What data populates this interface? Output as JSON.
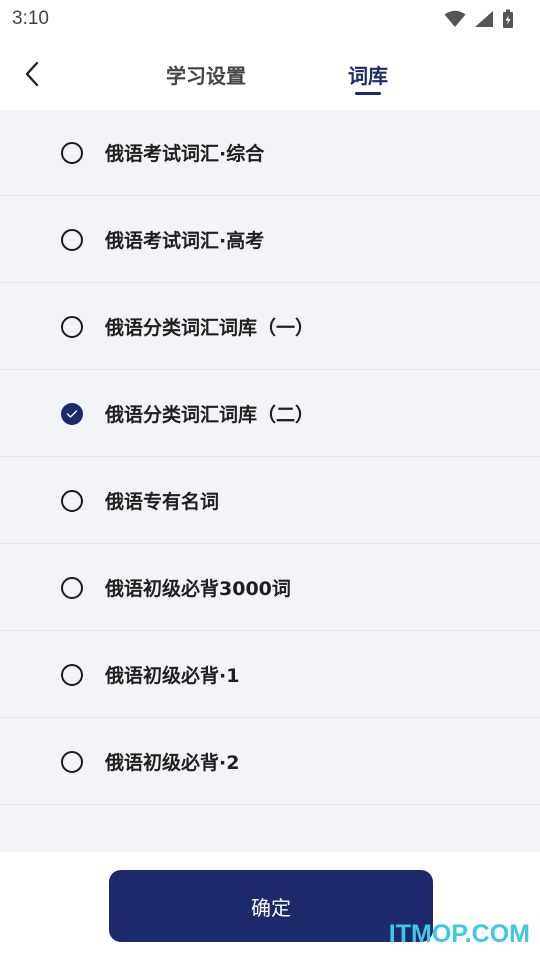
{
  "status_bar": {
    "time": "3:10",
    "icons": [
      "wifi-icon",
      "signal-icon",
      "battery-icon"
    ]
  },
  "header": {
    "back_icon": "chevron-left-icon",
    "tabs": [
      {
        "label": "学习设置",
        "active": false
      },
      {
        "label": "词库",
        "active": true
      }
    ]
  },
  "list": {
    "items": [
      {
        "label": "俄语考试词汇·综合",
        "checked": false
      },
      {
        "label": "俄语考试词汇·高考",
        "checked": false
      },
      {
        "label": "俄语分类词汇词库（一）",
        "checked": false
      },
      {
        "label": "俄语分类词汇词库（二）",
        "checked": true
      },
      {
        "label": "俄语专有名词",
        "checked": false
      },
      {
        "label": "俄语初级必背3000词",
        "checked": false
      },
      {
        "label": "俄语初级必背·1",
        "checked": false
      },
      {
        "label": "俄语初级必背·2",
        "checked": false
      }
    ]
  },
  "footer": {
    "confirm_label": "确定",
    "watermark": "ITMOP.COM"
  },
  "colors": {
    "accent": "#1c2a6b",
    "list_background": "#f3f4f8",
    "watermark": "#3ec7e6"
  }
}
